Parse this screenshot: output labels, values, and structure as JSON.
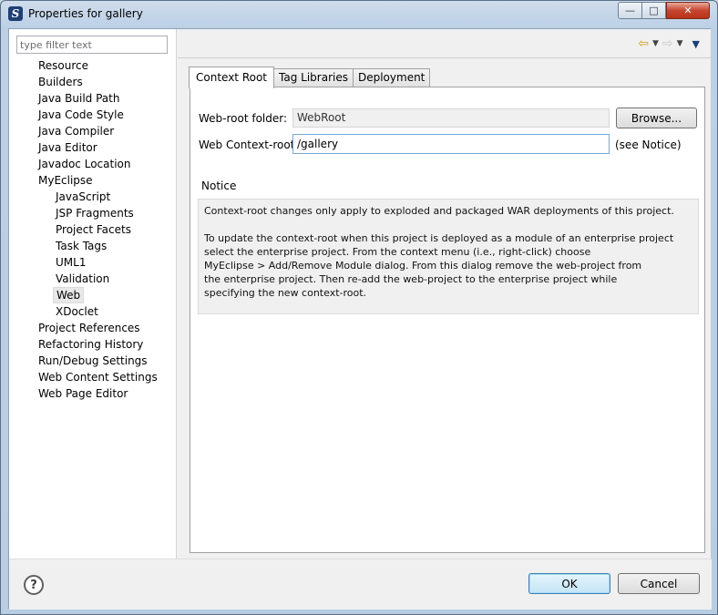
{
  "window": {
    "title": "Properties for gallery",
    "app_icon": "S",
    "controls": {
      "minimize": "—",
      "maximize": "□",
      "close": "✕"
    }
  },
  "filter": {
    "placeholder": "type filter text",
    "value": ""
  },
  "tree": {
    "items": [
      {
        "label": "Resource",
        "level": 0
      },
      {
        "label": "Builders",
        "level": 0
      },
      {
        "label": "Java Build Path",
        "level": 0
      },
      {
        "label": "Java Code Style",
        "level": 0
      },
      {
        "label": "Java Compiler",
        "level": 0
      },
      {
        "label": "Java Editor",
        "level": 0
      },
      {
        "label": "Javadoc Location",
        "level": 0
      },
      {
        "label": "MyEclipse",
        "level": 0
      },
      {
        "label": "JavaScript",
        "level": 1
      },
      {
        "label": "JSP Fragments",
        "level": 1
      },
      {
        "label": "Project Facets",
        "level": 1
      },
      {
        "label": "Task Tags",
        "level": 1
      },
      {
        "label": "UML1",
        "level": 1
      },
      {
        "label": "Validation",
        "level": 1
      },
      {
        "label": "Web",
        "level": 1,
        "selected": true
      },
      {
        "label": "XDoclet",
        "level": 1
      },
      {
        "label": "Project References",
        "level": 0
      },
      {
        "label": "Refactoring History",
        "level": 0
      },
      {
        "label": "Run/Debug Settings",
        "level": 0
      },
      {
        "label": "Web Content Settings",
        "level": 0
      },
      {
        "label": "Web Page Editor",
        "level": 0
      }
    ]
  },
  "nav": {
    "back_icon": "arrow-left-icon",
    "forward_icon": "arrow-right-icon",
    "back_glyph": "⇦",
    "forward_glyph": "⇨",
    "dropdown_glyph": "▼",
    "menu_glyph": "▼"
  },
  "tabs": [
    "Context Root",
    "Tag Libraries",
    "Deployment"
  ],
  "active_tab": 0,
  "form": {
    "webroot_label": "Web-root folder:",
    "webroot_value": "WebRoot",
    "browse_label": "Browse...",
    "context_label": "Web Context-root:",
    "context_value": "/gallery",
    "see_notice": "(see Notice)"
  },
  "notice": {
    "heading": "Notice",
    "paragraph1": "Context-root changes only apply to exploded and packaged WAR deployments of this project.",
    "paragraph2": "To update the context-root when this project is deployed as a module of an enterprise project\nselect the enterprise project. From the context menu (i.e., right-click) choose\nMyEclipse > Add/Remove Module dialog. From this dialog remove the web-project from\nthe enterprise project. Then re-add the web-project to the enterprise project while\nspecifying the new context-root."
  },
  "buttons": {
    "help": "?",
    "ok": "OK",
    "cancel": "Cancel"
  },
  "colors": {
    "selection_bg": "#e8e8e8",
    "ok_border": "#3c7fb1",
    "close_button": "#c6452e"
  }
}
